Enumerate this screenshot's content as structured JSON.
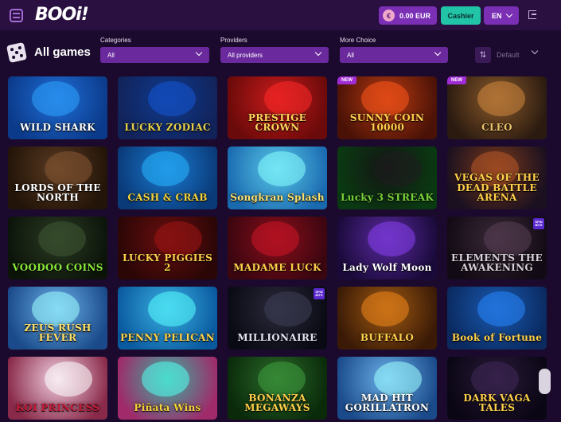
{
  "header": {
    "logo": "BOOi!",
    "balance": "0.00 EUR",
    "balance_currency_symbol": "€",
    "cashier": "Cashier",
    "language": "EN"
  },
  "filters": {
    "title": "All games",
    "categories": {
      "label": "Categories",
      "value": "All"
    },
    "providers": {
      "label": "Providers",
      "value": "All providers"
    },
    "more_choice": {
      "label": "More Choice",
      "value": "All"
    },
    "sort": {
      "value": "Default",
      "icon": "sort-icon"
    }
  },
  "games": [
    {
      "title": "WILD SHARK",
      "bg": [
        "#1f6ed6",
        "#0b3a8a"
      ],
      "color": "#ffffff",
      "badge": "",
      "flag": ""
    },
    {
      "title": "LUCKY ZODIAC",
      "bg": [
        "#0e3a8e",
        "#12235a"
      ],
      "color": "#e9d24a",
      "badge": "",
      "flag": ""
    },
    {
      "title": "PRESTIGE CROWN",
      "bg": [
        "#c81b1b",
        "#6a0a0a"
      ],
      "color": "#ffd75a",
      "badge": "",
      "flag": ""
    },
    {
      "title": "SUNNY COIN 10000",
      "bg": [
        "#b83a12",
        "#4a1206"
      ],
      "color": "#ffd04a",
      "badge": "NEW",
      "flag": ""
    },
    {
      "title": "CLEO",
      "bg": [
        "#8a5a2a",
        "#2a1a10"
      ],
      "color": "#e9c26a",
      "badge": "NEW",
      "flag": ""
    },
    {
      "title": "LORDS OF THE NORTH",
      "bg": [
        "#5a3a22",
        "#221408"
      ],
      "color": "#ffffff",
      "badge": "",
      "flag": ""
    },
    {
      "title": "CASH & CRAB",
      "bg": [
        "#1a7ad0",
        "#0a3a78"
      ],
      "color": "#f5d33a",
      "badge": "",
      "flag": ""
    },
    {
      "title": "Songkran Splash",
      "bg": [
        "#5ac8e8",
        "#1a6ab0"
      ],
      "color": "#ffe06a",
      "badge": "",
      "flag": ""
    },
    {
      "title": "Lucky 3 STREAK",
      "bg": [
        "#141414",
        "#0a3a12"
      ],
      "color": "#7ad23a",
      "badge": "",
      "flag": ""
    },
    {
      "title": "VEGAS OF THE DEAD BATTLE ARENA",
      "bg": [
        "#7a3a1a",
        "#1a1020"
      ],
      "color": "#ffd04a",
      "badge": "",
      "flag": ""
    },
    {
      "title": "VOODOO COINS",
      "bg": [
        "#2a3a22",
        "#0c140a"
      ],
      "color": "#8ae83a",
      "badge": "",
      "flag": ""
    },
    {
      "title": "LUCKY PIGGIES 2",
      "bg": [
        "#6a0e0e",
        "#2a0606"
      ],
      "color": "#ffd04a",
      "badge": "",
      "flag": ""
    },
    {
      "title": "MADAME LUCK",
      "bg": [
        "#8a0e1a",
        "#3a0610"
      ],
      "color": "#ffd04a",
      "badge": "",
      "flag": ""
    },
    {
      "title": "Lady Wolf Moon",
      "bg": [
        "#5a2aa0",
        "#1a0a3a"
      ],
      "color": "#ffffff",
      "badge": "",
      "flag": ""
    },
    {
      "title": "ELEMENTS THE AWAKENING",
      "bg": [
        "#3a2a38",
        "#120a14"
      ],
      "color": "#d8d0d8",
      "badge": "",
      "flag": "SPIN BITS"
    },
    {
      "title": "ZEUS RUSH FEVER",
      "bg": [
        "#6ab0e8",
        "#1a4a8a"
      ],
      "color": "#ffe06a",
      "badge": "",
      "flag": ""
    },
    {
      "title": "PENNY PELICAN",
      "bg": [
        "#3ab0e0",
        "#0a5aa0"
      ],
      "color": "#ffd04a",
      "badge": "",
      "flag": ""
    },
    {
      "title": "MILLIONAIRE",
      "bg": [
        "#2a2a3a",
        "#0a0a14"
      ],
      "color": "#e0e0f0",
      "badge": "",
      "flag": "SPIN BITS"
    },
    {
      "title": "BUFFALO",
      "bg": [
        "#a05a12",
        "#3a1a06"
      ],
      "color": "#ffd04a",
      "badge": "",
      "flag": ""
    },
    {
      "title": "Book of Fortune",
      "bg": [
        "#1a5ab0",
        "#0a2a60"
      ],
      "color": "#ffd04a",
      "badge": "",
      "flag": ""
    },
    {
      "title": "KOI PRINCESS",
      "bg": [
        "#f0d0e0",
        "#8a2a4a"
      ],
      "color": "#c81b3a",
      "badge": "",
      "flag": ""
    },
    {
      "title": "Piñata Wins",
      "bg": [
        "#3ab0a0",
        "#a02a6a"
      ],
      "color": "#f5d33a",
      "badge": "",
      "flag": ""
    },
    {
      "title": "BONANZA MEGAWAYS",
      "bg": [
        "#2a6a2a",
        "#0a2a0a"
      ],
      "color": "#ffd04a",
      "badge": "",
      "flag": ""
    },
    {
      "title": "MAD HIT GORILLATRON",
      "bg": [
        "#6ab0e8",
        "#1a4a8a"
      ],
      "color": "#ffffff",
      "badge": "",
      "flag": ""
    },
    {
      "title": "DARK VAGA TALES",
      "bg": [
        "#2a1a3a",
        "#0a0614"
      ],
      "color": "#ffd04a",
      "badge": "",
      "flag": ""
    }
  ]
}
